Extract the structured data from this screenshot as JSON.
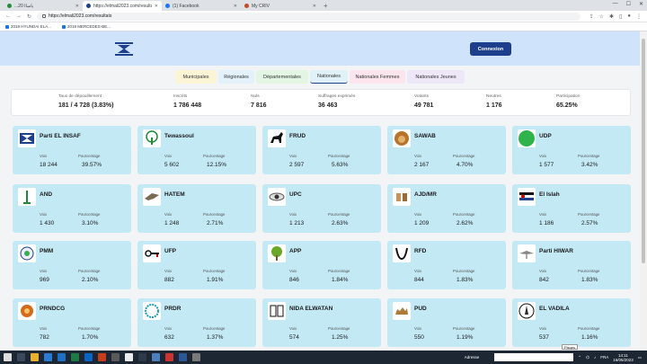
{
  "browser": {
    "tabs": [
      {
        "label": "...ياساا 20"
      },
      {
        "label": "https://elmali2023.com/resultats"
      },
      {
        "label": "(1) Facebook"
      },
      {
        "label": "My CRIV"
      }
    ],
    "new_tab": "+",
    "url": "https://elmali2023.com/resultats",
    "bookmarks": [
      "2019 HYUNDAI ELA...",
      "2019 MERCEDES-BE..."
    ]
  },
  "header": {
    "connexion_label": "Connexion"
  },
  "election_tabs": [
    "Municipales",
    "Régionales",
    "Départementales",
    "Nationales",
    "Nationales Femmes",
    "Nationales Jeunes"
  ],
  "stats": [
    {
      "label": "Taux de dépouillement",
      "value": "181 / 4 728 (3.83%)"
    },
    {
      "label": "Inscrits",
      "value": "1 786 448"
    },
    {
      "label": "Nuls",
      "value": "7 816"
    },
    {
      "label": "Suffrages exprimés",
      "value": "36 463"
    },
    {
      "label": "Votants",
      "value": "49 781"
    },
    {
      "label": "Neutres",
      "value": "1 176"
    },
    {
      "label": "Participation",
      "value": "65.25%"
    }
  ],
  "card_labels": {
    "voix": "Voix",
    "pourcentage": "Pourcentage"
  },
  "parties": [
    {
      "name": "Parti EL INSAF",
      "voix": "18 244",
      "pct": "39.57%",
      "icon": "insaf-flag-icon"
    },
    {
      "name": "Tewassoul",
      "voix": "5 602",
      "pct": "12.15%",
      "icon": "palm-tree-icon"
    },
    {
      "name": "FRUD",
      "voix": "2 597",
      "pct": "5.63%",
      "icon": "horse-icon"
    },
    {
      "name": "SAWAB",
      "voix": "2 167",
      "pct": "4.70%",
      "icon": "lion-icon"
    },
    {
      "name": "UDP",
      "voix": "1 577",
      "pct": "3.42%",
      "icon": "green-circle-icon"
    },
    {
      "name": "AND",
      "voix": "1 430",
      "pct": "3.10%",
      "icon": "minaret-icon"
    },
    {
      "name": "HATEM",
      "voix": "1 248",
      "pct": "2.71%",
      "icon": "hawk-icon"
    },
    {
      "name": "UPC",
      "voix": "1 213",
      "pct": "2.63%",
      "icon": "eye-icon"
    },
    {
      "name": "AJD/MR",
      "voix": "1 209",
      "pct": "2.62%",
      "icon": "hands-icon"
    },
    {
      "name": "El Islah",
      "voix": "1 186",
      "pct": "2.57%",
      "icon": "islah-flag-icon"
    },
    {
      "name": "PMM",
      "voix": "969",
      "pct": "2.10%",
      "icon": "pmm-emblem-icon"
    },
    {
      "name": "UFP",
      "voix": "882",
      "pct": "1.91%",
      "icon": "key-icon"
    },
    {
      "name": "APP",
      "voix": "846",
      "pct": "1.84%",
      "icon": "tree-icon"
    },
    {
      "name": "RFD",
      "voix": "844",
      "pct": "1.83%",
      "icon": "horns-icon"
    },
    {
      "name": "Parti HIWAR",
      "voix": "842",
      "pct": "1.83%",
      "icon": "dove-icon"
    },
    {
      "name": "PRNDCG",
      "voix": "782",
      "pct": "1.70%",
      "icon": "sun-icon"
    },
    {
      "name": "PRDR",
      "voix": "632",
      "pct": "1.37%",
      "icon": "wreath-icon"
    },
    {
      "name": "NIDA ELWATAN",
      "voix": "574",
      "pct": "1.25%",
      "icon": "faces-icon"
    },
    {
      "name": "PUD",
      "voix": "550",
      "pct": "1.19%",
      "icon": "camel-icon"
    },
    {
      "name": "EL VADILA",
      "voix": "537",
      "pct": "1.16%",
      "icon": "vadila-emblem-icon"
    }
  ],
  "taskbar": {
    "search_label": "Adresse",
    "tooltip": "Pisqes",
    "lang": "FRA",
    "time": "14:11",
    "date": "16/05/2023"
  }
}
